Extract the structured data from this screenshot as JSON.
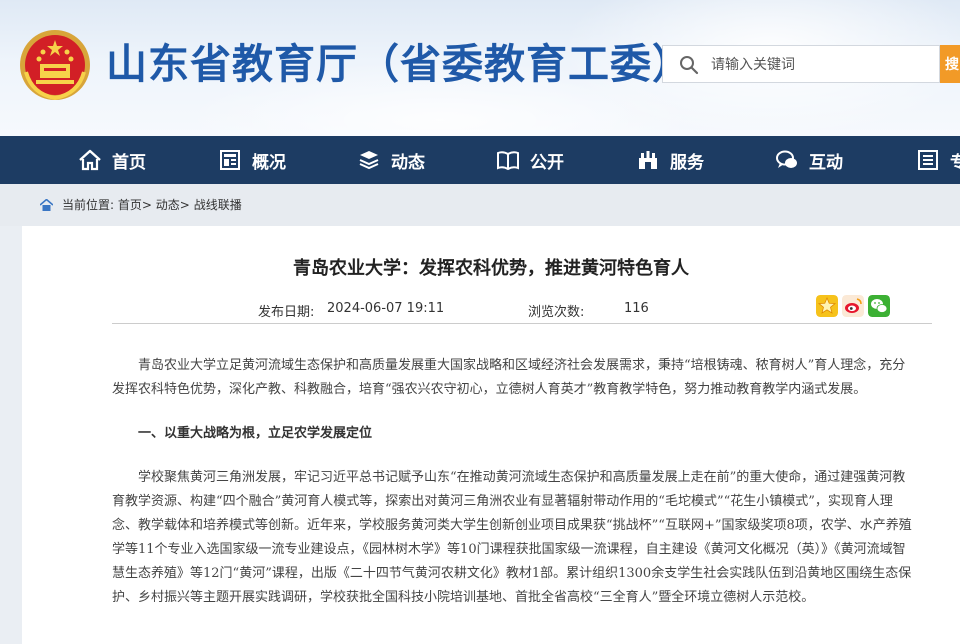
{
  "header": {
    "site_title": "山东省教育厅（省委教育工委）",
    "search_placeholder": "请输入关键词",
    "search_button": "搜"
  },
  "nav": {
    "items": [
      {
        "label": "首页",
        "icon": "home-icon"
      },
      {
        "label": "概况",
        "icon": "overview-icon"
      },
      {
        "label": "动态",
        "icon": "news-icon"
      },
      {
        "label": "公开",
        "icon": "book-icon"
      },
      {
        "label": "服务",
        "icon": "service-icon"
      },
      {
        "label": "互动",
        "icon": "chat-icon"
      },
      {
        "label": "专",
        "icon": "topic-icon"
      }
    ]
  },
  "breadcrumb": {
    "prefix": "当前位置:",
    "items": [
      "首页",
      "动态",
      "战线联播"
    ],
    "sep": ">"
  },
  "article": {
    "title": "青岛农业大学：发挥农科优势，推进黄河特色育人",
    "date_label": "发布日期:",
    "date_value": "2024-06-07 19:11",
    "views_label": "浏览次数:",
    "views_value": "116",
    "share_icons": [
      "qzone-star-icon",
      "weibo-icon",
      "wechat-icon"
    ],
    "paragraphs": [
      "青岛农业大学立足黄河流域生态保护和高质量发展重大国家战略和区域经济社会发展需求，秉持“培根铸魂、秾育树人”育人理念，充分发挥农科特色优势，深化产教、科教融合，培育“强农兴农守初心，立德树人育英才”教育教学特色，努力推动教育教学内涵式发展。",
      "一、以重大战略为根，立足农学发展定位",
      "学校聚焦黄河三角洲发展，牢记习近平总书记赋予山东“在推动黄河流域生态保护和高质量发展上走在前”的重大使命，通过建强黄河教育教学资源、构建“四个融合”黄河育人模式等，探索出对黄河三角洲农业有显著辐射带动作用的“毛坨模式”“花生小镇模式”，实现育人理念、教学载体和培养模式等创新。近年来，学校服务黄河类大学生创新创业项目成果获“挑战杯”“互联网+”国家级奖项8项，农学、水产养殖学等11个专业入选国家级一流专业建设点，《园林树木学》等10门课程获批国家级一流课程，自主建设《黄河文化概况（英）》《黄河流域智慧生态养殖》等12门“黄河”课程，出版《二十四节气黄河农耕文化》教材1部。累计组织1300余支学生社会实践队伍到沿黄地区围绕生态保护、乡村振兴等主题开展实践调研，学校获批全国科技小院培训基地、首批全省高校“三全育人”暨全环境立德树人示范校。"
    ]
  },
  "colors": {
    "title_blue": "#1f59a8",
    "nav_bg": "#1d3c63",
    "search_orange": "#f29a27"
  }
}
